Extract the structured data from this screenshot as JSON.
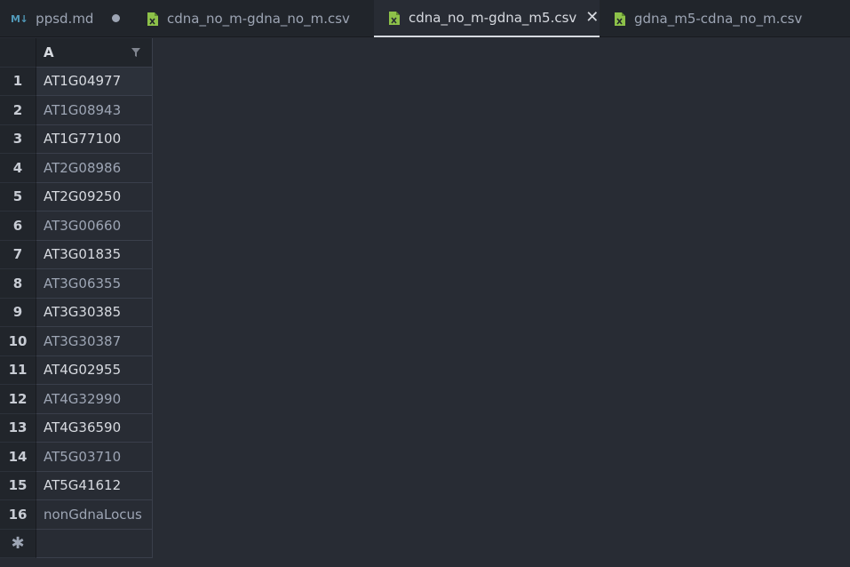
{
  "tabs": [
    {
      "label": "ppsd.md",
      "icon": "markdown-icon",
      "icon_text": "M↓",
      "dirty": true,
      "active": false
    },
    {
      "label": "cdna_no_m-gdna_no_m.csv",
      "icon": "csv-file-icon",
      "active": false
    },
    {
      "label": "cdna_no_m-gdna_m5.csv",
      "icon": "csv-file-icon",
      "active": true,
      "close": "✕"
    },
    {
      "label": "gdna_m5-cdna_no_m.csv",
      "icon": "csv-file-icon",
      "active": false
    }
  ],
  "grid": {
    "column_header": "A",
    "new_row_marker": "✱",
    "rows": [
      {
        "num": "1",
        "value": "AT1G04977"
      },
      {
        "num": "2",
        "value": "AT1G08943"
      },
      {
        "num": "3",
        "value": "AT1G77100"
      },
      {
        "num": "4",
        "value": "AT2G08986"
      },
      {
        "num": "5",
        "value": "AT2G09250"
      },
      {
        "num": "6",
        "value": "AT3G00660"
      },
      {
        "num": "7",
        "value": "AT3G01835"
      },
      {
        "num": "8",
        "value": "AT3G06355"
      },
      {
        "num": "9",
        "value": "AT3G30385"
      },
      {
        "num": "10",
        "value": "AT3G30387"
      },
      {
        "num": "11",
        "value": "AT4G02955"
      },
      {
        "num": "12",
        "value": "AT4G32990"
      },
      {
        "num": "13",
        "value": "AT4G36590"
      },
      {
        "num": "14",
        "value": "AT5G03710"
      },
      {
        "num": "15",
        "value": "AT5G41612"
      },
      {
        "num": "16",
        "value": "nonGdnaLocus"
      }
    ]
  },
  "colors": {
    "csv_icon": "#8dc149",
    "markdown_icon": "#519aba",
    "background": "#282c34",
    "tabbar": "#21252b"
  }
}
